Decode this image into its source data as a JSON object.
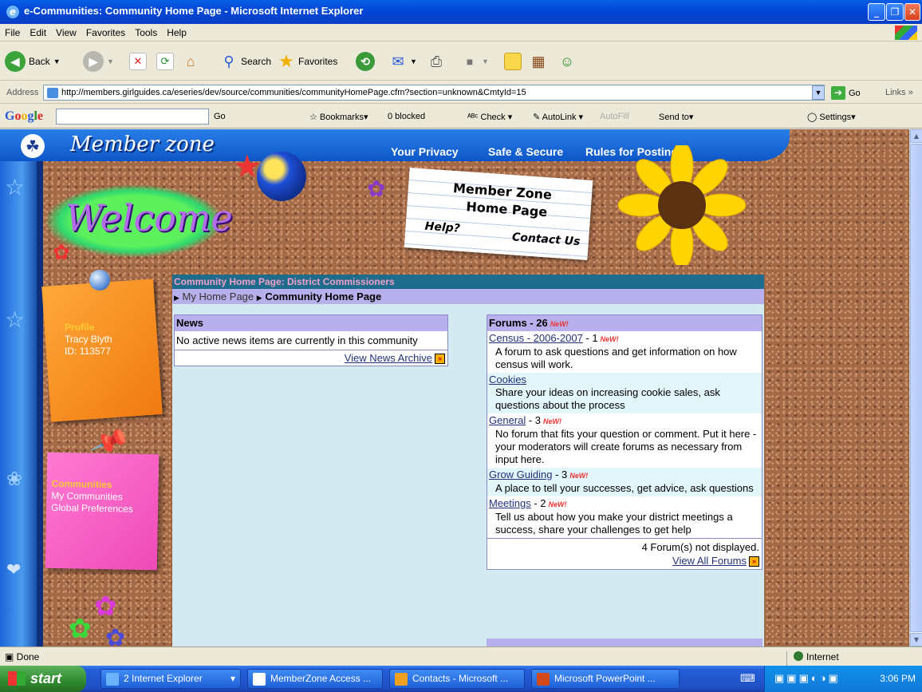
{
  "window": {
    "title": "e-Communities: Community Home Page - Microsoft Internet Explorer"
  },
  "menu": [
    "File",
    "Edit",
    "View",
    "Favorites",
    "Tools",
    "Help"
  ],
  "toolbar": {
    "back": "Back",
    "search": "Search",
    "favorites": "Favorites"
  },
  "address": {
    "label": "Address",
    "url": "http://members.girlguides.ca/eseries/dev/source/communities/communityHomePage.cfm?section=unknown&CmtyId=15",
    "go": "Go",
    "links": "Links"
  },
  "googlebar": {
    "logo": "Google",
    "go": "Go",
    "bookmarks": "Bookmarks",
    "blocked": "0 blocked",
    "check": "Check",
    "autolink": "AutoLink",
    "autofill": "AutoFill",
    "sendto": "Send to",
    "settings": "Settings"
  },
  "site": {
    "brand": "Member zone",
    "links": [
      "Your Privacy",
      "Safe & Secure",
      "Rules for Posting"
    ],
    "welcome": "Welcome",
    "note": {
      "line1": "Member Zone",
      "line2": "Home Page",
      "help": "Help?",
      "contact": "Contact Us"
    }
  },
  "profile": {
    "heading": "Profile",
    "name": "Tracy Blyth",
    "id": "ID: 113577"
  },
  "communities": {
    "heading": "Communities",
    "items": [
      "My Communities",
      "Global Preferences"
    ]
  },
  "content": {
    "header": "Community Home Page: District Commissioners",
    "breadcrumb": {
      "home": "My Home Page",
      "current": "Community Home Page"
    },
    "news": {
      "title": "News",
      "body": "No active news items are currently in this community",
      "archive": "View News Archive"
    },
    "forums": {
      "title": "Forums - 26",
      "new_label": "NeW!",
      "items": [
        {
          "name": "Census - 2006-2007",
          "count": " - 1",
          "new": true,
          "desc": "A forum to ask questions and get information on how census will work."
        },
        {
          "name": "Cookies",
          "count": "",
          "new": false,
          "desc": "Share your ideas on increasing cookie sales, ask questions about the process"
        },
        {
          "name": "General",
          "count": " - 3",
          "new": true,
          "desc": "No forum that fits your question or comment. Put it here - your moderators will create forums as necessary from input here."
        },
        {
          "name": "Grow Guiding",
          "count": " - 3",
          "new": true,
          "desc": "A place to tell your successes, get advice, ask questions"
        },
        {
          "name": "Meetings",
          "count": " - 2",
          "new": true,
          "desc": "Tell us about how you make your district meetings a success, share your challenges to get help"
        }
      ],
      "not_displayed": "4 Forum(s) not displayed.",
      "view_all": "View All Forums"
    }
  },
  "status": {
    "left": "Done",
    "zone": "Internet"
  },
  "taskbar": {
    "start": "start",
    "tasks": [
      "2 Internet Explorer",
      "MemberZone Access ...",
      "Contacts - Microsoft ...",
      "Microsoft PowerPoint ..."
    ],
    "time": "3:06 PM"
  },
  "colors": {
    "accent_blue": "#0a5ee6",
    "header_teal": "#1e6c8c",
    "lavender": "#b7b0ec",
    "new_red": "#e33333"
  }
}
